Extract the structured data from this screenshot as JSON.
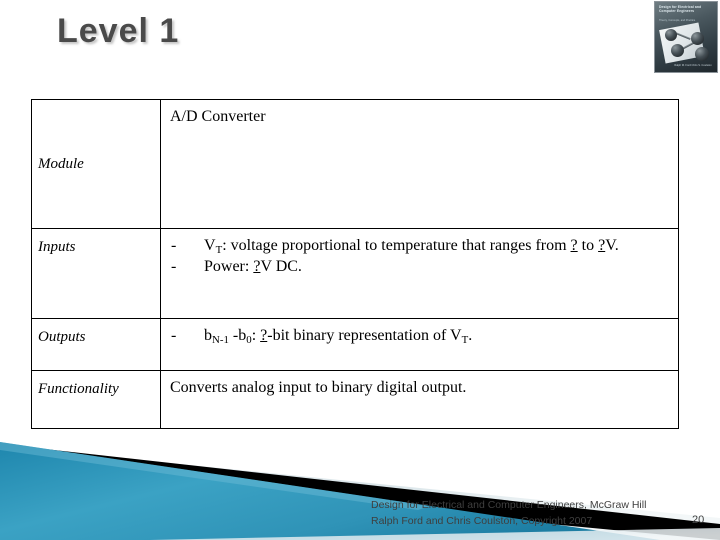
{
  "slide": {
    "title": "Level 1",
    "page_number": "20",
    "accent_teal": "#2f93b7",
    "accent_black": "#000000",
    "title_color": "#4a4a4a"
  },
  "book_cover": {
    "alt": "book-cover-thumbnail",
    "title_line": "Design for Electrical and Computer Engineers",
    "subtitle_line": "Theory, Concepts, and Practice",
    "authors_line": "Ralph M. Ford\nChris S. Coulston"
  },
  "table": {
    "rows": [
      {
        "label": "Module",
        "value": "A/D Converter",
        "kind": "plain"
      },
      {
        "label": "Inputs",
        "kind": "bullets",
        "bullets": [
          {
            "dash": "-",
            "segments": [
              {
                "t": "V",
                "style": "normal"
              },
              {
                "t": "T",
                "style": "sub"
              },
              {
                "t": ": voltage proportional to temperature that ranges from ",
                "style": "normal"
              },
              {
                "t": "?",
                "style": "underline"
              },
              {
                "t": " to ",
                "style": "normal"
              },
              {
                "t": "?",
                "style": "underline"
              },
              {
                "t": "V.",
                "style": "normal"
              }
            ]
          },
          {
            "dash": "-",
            "segments": [
              {
                "t": "Power: ",
                "style": "normal"
              },
              {
                "t": "?",
                "style": "underline"
              },
              {
                "t": "V DC.",
                "style": "normal"
              }
            ]
          }
        ]
      },
      {
        "label": "Outputs",
        "kind": "bullets",
        "bullets": [
          {
            "dash": "-",
            "segments": [
              {
                "t": "b",
                "style": "normal"
              },
              {
                "t": "N-1",
                "style": "sub"
              },
              {
                "t": " -b",
                "style": "normal"
              },
              {
                "t": "0",
                "style": "sub"
              },
              {
                "t": ": ",
                "style": "normal"
              },
              {
                "t": "?",
                "style": "underline"
              },
              {
                "t": "-bit binary representation of V",
                "style": "normal"
              },
              {
                "t": "T",
                "style": "sub"
              },
              {
                "t": ".",
                "style": "normal"
              }
            ]
          }
        ]
      },
      {
        "label": "Functionality",
        "value": "Converts analog input to binary digital output.",
        "kind": "plain"
      }
    ]
  },
  "footer": {
    "line1": "Design for Electrical and Computer Engineers, McGraw Hill",
    "line2": "Ralph Ford and Chris Coulston, Copyright 2007"
  }
}
